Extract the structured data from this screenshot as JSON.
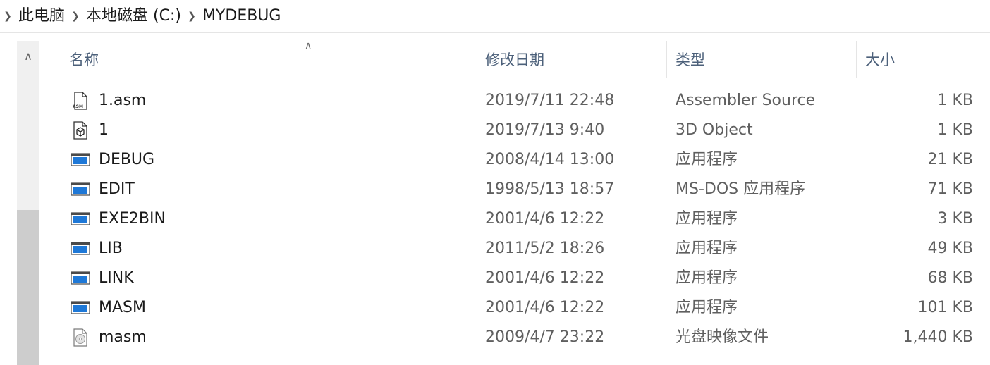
{
  "breadcrumb": {
    "items": [
      "此电脑",
      "本地磁盘 (C:)",
      "MYDEBUG"
    ]
  },
  "columns": {
    "name": "名称",
    "date": "修改日期",
    "type": "类型",
    "size": "大小"
  },
  "files": [
    {
      "name": "1.asm",
      "date": "2019/7/11 22:48",
      "type": "Assembler Source",
      "size": "1 KB",
      "icon": "asm-file-icon"
    },
    {
      "name": "1",
      "date": "2019/7/13 9:40",
      "type": "3D Object",
      "size": "1 KB",
      "icon": "3d-object-file-icon"
    },
    {
      "name": "DEBUG",
      "date": "2008/4/14 13:00",
      "type": "应用程序",
      "size": "21 KB",
      "icon": "application-icon"
    },
    {
      "name": "EDIT",
      "date": "1998/5/13 18:57",
      "type": "MS-DOS 应用程序",
      "size": "71 KB",
      "icon": "application-icon"
    },
    {
      "name": "EXE2BIN",
      "date": "2001/4/6 12:22",
      "type": "应用程序",
      "size": "3 KB",
      "icon": "application-icon"
    },
    {
      "name": "LIB",
      "date": "2011/5/2 18:26",
      "type": "应用程序",
      "size": "49 KB",
      "icon": "application-icon"
    },
    {
      "name": "LINK",
      "date": "2001/4/6 12:22",
      "type": "应用程序",
      "size": "68 KB",
      "icon": "application-icon"
    },
    {
      "name": "MASM",
      "date": "2001/4/6 12:22",
      "type": "应用程序",
      "size": "101 KB",
      "icon": "application-icon"
    },
    {
      "name": "masm",
      "date": "2009/4/7 23:22",
      "type": "光盘映像文件",
      "size": "1,440 KB",
      "icon": "disc-image-icon"
    }
  ]
}
